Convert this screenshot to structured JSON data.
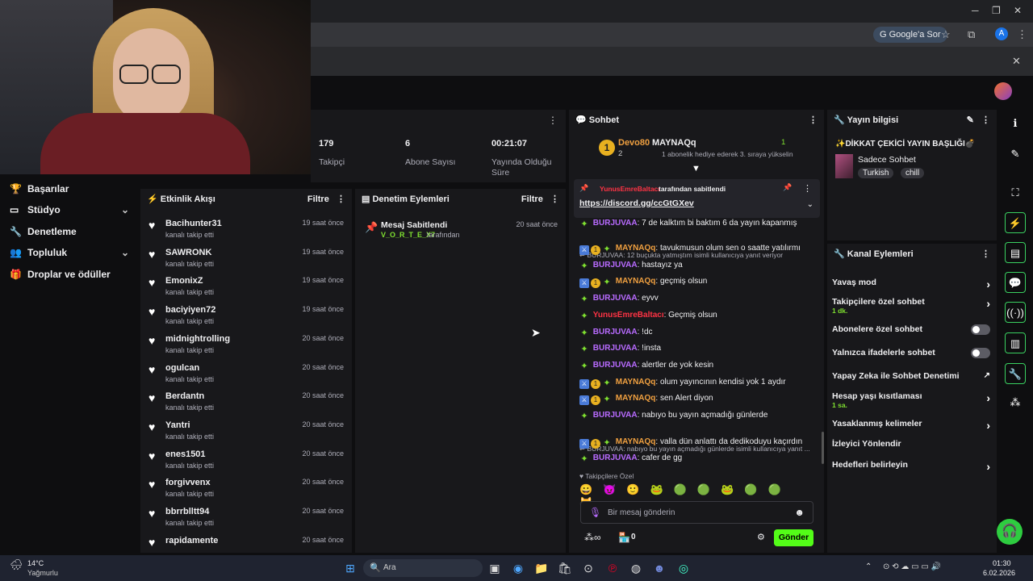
{
  "browser": {
    "google_btn": "Google'a Sor",
    "avatar_letter": "A"
  },
  "nav": {
    "items": [
      {
        "label": "Başarılar",
        "icon": "trophy-icon"
      },
      {
        "label": "Stüdyo",
        "icon": "studio-icon"
      },
      {
        "label": "Denetleme",
        "icon": "wrench-icon"
      },
      {
        "label": "Topluluk",
        "icon": "people-icon"
      },
      {
        "label": "Droplar ve ödüller",
        "icon": "gift-icon"
      }
    ]
  },
  "stats": {
    "followers_value": "179",
    "followers_label": "Takipçi",
    "subs_value": "6",
    "subs_label": "Abone Sayısı",
    "uptime_value": "00:21:07",
    "uptime_label": "Yayında Olduğu Süre"
  },
  "activity": {
    "title": "Etkinlik Akışı",
    "filter": "Filtre",
    "events": [
      {
        "name": "Bacihunter31",
        "sub": "kanalı takip etti",
        "time": "19 saat önce"
      },
      {
        "name": "SAWRONK",
        "sub": "kanalı takip etti",
        "time": "19 saat önce"
      },
      {
        "name": "EmonixZ",
        "sub": "kanalı takip etti",
        "time": "19 saat önce"
      },
      {
        "name": "baciyiyen72",
        "sub": "kanalı takip etti",
        "time": "19 saat önce"
      },
      {
        "name": "midnightrolling",
        "sub": "kanalı takip etti",
        "time": "20 saat önce"
      },
      {
        "name": "ogulcan",
        "sub": "kanalı takip etti",
        "time": "20 saat önce"
      },
      {
        "name": "Berdantn",
        "sub": "kanalı takip etti",
        "time": "20 saat önce"
      },
      {
        "name": "Yantri",
        "sub": "kanalı takip etti",
        "time": "20 saat önce"
      },
      {
        "name": "enes1501",
        "sub": "kanalı takip etti",
        "time": "20 saat önce"
      },
      {
        "name": "forgivvenx",
        "sub": "kanalı takip etti",
        "time": "20 saat önce"
      },
      {
        "name": "bbrrblltt94",
        "sub": "kanalı takip etti",
        "time": "20 saat önce"
      },
      {
        "name": "rapidamente",
        "sub": "",
        "time": "20 saat önce"
      }
    ]
  },
  "moderation": {
    "title": "Denetim Eylemleri",
    "filter": "Filtre",
    "action": "Mesaj Sabitlendi",
    "by_user": "V_O_R_T_E_X7",
    "by_suffix": "tarafından",
    "time": "20 saat önce"
  },
  "chat": {
    "title": "Sohbet",
    "leader1_name": "Devo80",
    "leader1_count": "2",
    "leader2_name": "MAYNAQq",
    "leader2_count": "1",
    "leader_note": "1 abonelik hediye ederek 3. sıraya yükselin",
    "pinned_by": "YunusEmreBaltacı",
    "pinned_suffix": "tarafından sabitlendi",
    "pinned_link": "https://discord.gg/ccGtGXev",
    "messages": [
      {
        "user": "BURJUVAA",
        "text": ": 7 de kalktım bi baktım 6 da yayın kapanmış"
      },
      {
        "reply": "BURJUVAA: 12 buçukta yatmıştım isimli kullanıcıya yanıt veriyor"
      },
      {
        "user": "MAYNAQq",
        "text": ": tavukmusun olum sen o saatte yatılırmı"
      },
      {
        "user": "BURJUVAA",
        "text": ": hastayız ya"
      },
      {
        "user": "MAYNAQq",
        "text": ": geçmiş olsun"
      },
      {
        "user": "BURJUVAA",
        "text": ": eyvv"
      },
      {
        "user": "YunusEmreBaltacı",
        "text": ": Geçmiş olsun"
      },
      {
        "user": "BURJUVAA",
        "text": ": !dc"
      },
      {
        "user": "BURJUVAA",
        "text": ": !insta"
      },
      {
        "user": "BURJUVAA",
        "text": ": alertler de yok kesin"
      },
      {
        "user": "MAYNAQq",
        "text": ": olum yayıncının kendisi yok 1 aydır"
      },
      {
        "user": "MAYNAQq",
        "text": ": sen Alert diyon"
      },
      {
        "user": "BURJUVAA",
        "text": ": nabıyo bu yayın açmadığı günlerde"
      },
      {
        "reply": "BURJUVAA: nabıyo bu yayın açmadığı günlerde isimli kullanıcıya yanıt ..."
      },
      {
        "user": "MAYNAQq",
        "text": ": valla dün anlattı da dedikoduyu kaçırdın"
      },
      {
        "user": "BURJUVAA",
        "text": ": cafer de gg"
      }
    ],
    "followers_only": "Takipçilere Özel",
    "input_placeholder": "Bir mesaj gönderin",
    "send": "Gönder",
    "points": "0"
  },
  "stream_info": {
    "title": "Yayın bilgisi",
    "stream_title": "✨DİKKAT ÇEKİCİ YAYIN BAŞLIĞI💣",
    "category": "Sadece Sohbet",
    "tags": [
      "Turkish",
      "chill"
    ]
  },
  "channel_actions": {
    "title": "Kanal Eylemleri",
    "items": [
      {
        "label": "Yavaş mod"
      },
      {
        "label": "Takipçilere özel sohbet",
        "sub": "1 dk."
      },
      {
        "label": "Abonelere özel sohbet"
      },
      {
        "label": "Yalnızca ifadelerle sohbet"
      },
      {
        "label": "Yapay Zeka ile Sohbet Denetimi"
      },
      {
        "label": "Hesap yaşı kısıtlaması",
        "sub": "1 sa."
      },
      {
        "label": "Yasaklanmış kelimeler"
      },
      {
        "label": "İzleyici Yönlendir"
      },
      {
        "label": "Hedefleri belirleyin"
      }
    ]
  },
  "taskbar": {
    "weather_temp": "14°C",
    "weather_desc": "Yağmurlu",
    "search": "Ara",
    "time": "01:30",
    "date": "6.02.2026"
  },
  "colors": {
    "accent_green": "#53fc18",
    "purple_user": "#b86bff",
    "orange_user": "#f0a040"
  }
}
